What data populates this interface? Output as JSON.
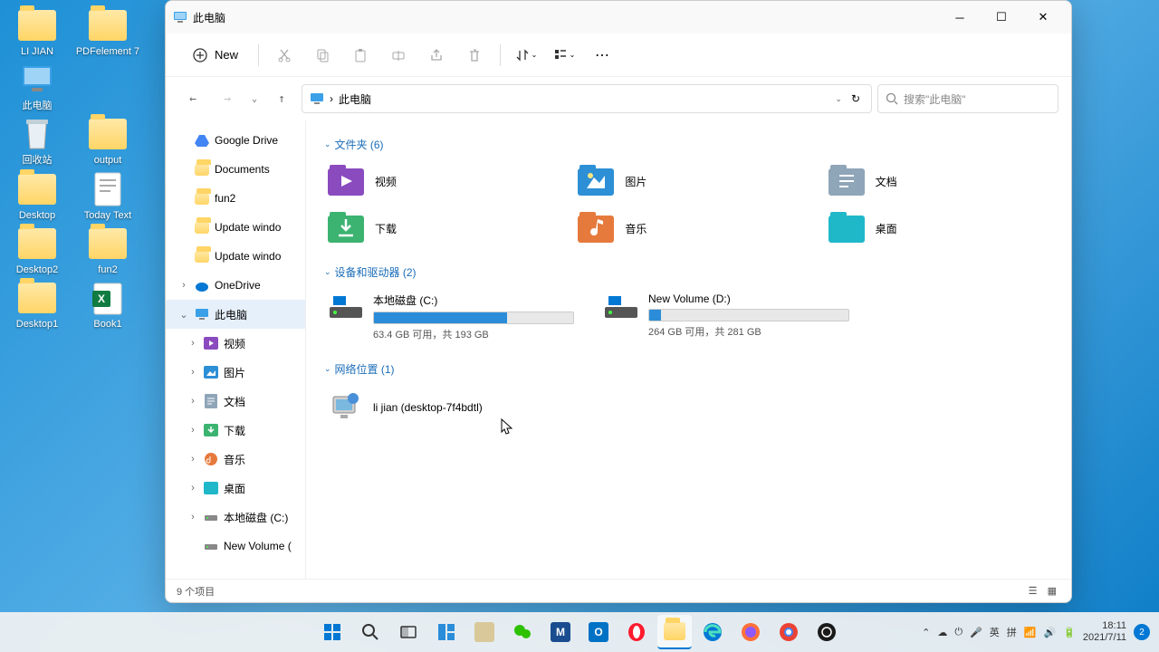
{
  "window": {
    "title": "此电脑",
    "new_button": "New"
  },
  "breadcrumb": {
    "root": "此电脑"
  },
  "search": {
    "placeholder": "搜索\"此电脑\""
  },
  "sidebar": {
    "items": [
      {
        "label": "Google Drive",
        "icon": "gdrive",
        "chev": ""
      },
      {
        "label": "Documents",
        "icon": "folder",
        "chev": ""
      },
      {
        "label": "fun2",
        "icon": "folder",
        "chev": ""
      },
      {
        "label": "Update windo",
        "icon": "folder",
        "chev": ""
      },
      {
        "label": "Update windo",
        "icon": "folder",
        "chev": ""
      },
      {
        "label": "OneDrive",
        "icon": "onedrive",
        "chev": "›"
      },
      {
        "label": "此电脑",
        "icon": "pc",
        "chev": "⌄",
        "sel": true
      },
      {
        "label": "视频",
        "icon": "video",
        "chev": "›",
        "indent": true
      },
      {
        "label": "图片",
        "icon": "picture",
        "chev": "›",
        "indent": true
      },
      {
        "label": "文档",
        "icon": "doc",
        "chev": "›",
        "indent": true
      },
      {
        "label": "下载",
        "icon": "download",
        "chev": "›",
        "indent": true
      },
      {
        "label": "音乐",
        "icon": "music",
        "chev": "›",
        "indent": true
      },
      {
        "label": "桌面",
        "icon": "desktop",
        "chev": "›",
        "indent": true
      },
      {
        "label": "本地磁盘 (C:)",
        "icon": "drive",
        "chev": "›",
        "indent": true
      },
      {
        "label": "New Volume (",
        "icon": "drive",
        "chev": "",
        "indent": true
      }
    ]
  },
  "groups": {
    "folders_hdr": "文件夹 (6)",
    "drives_hdr": "设备和驱动器 (2)",
    "net_hdr": "网络位置 (1)"
  },
  "folders": [
    {
      "label": "视频",
      "color": "#8a4bbf",
      "name": "videos"
    },
    {
      "label": "图片",
      "color": "#2d8fd5",
      "name": "pictures"
    },
    {
      "label": "文档",
      "color": "#8fa5b8",
      "name": "documents"
    },
    {
      "label": "下载",
      "color": "#3cb371",
      "name": "downloads"
    },
    {
      "label": "音乐",
      "color": "#e67a3c",
      "name": "music"
    },
    {
      "label": "桌面",
      "color": "#1fb8c9",
      "name": "desktop"
    }
  ],
  "drives": [
    {
      "name": "本地磁盘 (C:)",
      "status": "63.4 GB 可用，共 193 GB",
      "pct": 67
    },
    {
      "name": "New Volume (D:)",
      "status": "264 GB 可用，共 281 GB",
      "pct": 6
    }
  ],
  "network": {
    "label": "li jian (desktop-7f4bdtl)"
  },
  "status": {
    "left": "9 个项目"
  },
  "desktop_icons": [
    {
      "label": "LI JIAN",
      "type": "folder"
    },
    {
      "label": "PDFelement 7",
      "type": "folder"
    },
    {
      "label": "此电脑",
      "type": "pc"
    },
    {
      "label": "",
      "type": "spacer"
    },
    {
      "label": "回收站",
      "type": "bin"
    },
    {
      "label": "output",
      "type": "folder"
    },
    {
      "label": "Desktop",
      "type": "folder"
    },
    {
      "label": "Today Text",
      "type": "text"
    },
    {
      "label": "Desktop2",
      "type": "folder"
    },
    {
      "label": "fun2",
      "type": "folder"
    },
    {
      "label": "Desktop1",
      "type": "folder"
    },
    {
      "label": "Book1",
      "type": "xlsx"
    }
  ],
  "taskbar": {
    "ime1": "英",
    "ime2": "拼",
    "time": "18:11",
    "date": "2021/7/11",
    "badge": "2"
  }
}
